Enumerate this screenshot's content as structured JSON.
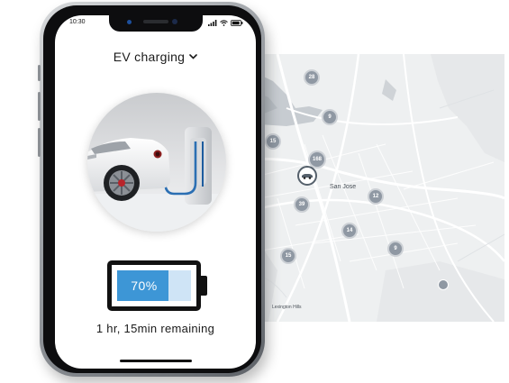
{
  "status_bar": {
    "time": "10:30",
    "icons": [
      "signal-icon",
      "wifi-icon",
      "battery-icon"
    ]
  },
  "app": {
    "title": "EV charging",
    "dropdown_icon": "chevron-down-icon"
  },
  "charging": {
    "percent_label": "70%",
    "level": 0.7,
    "remaining_text": "1 hr, 15min remaining"
  },
  "map": {
    "city_label": "San Jose",
    "area_label": "Lexington Hills",
    "clusters": [
      "28",
      "9",
      "15",
      "168",
      "74",
      "12",
      "39",
      "14",
      "9",
      "15"
    ]
  },
  "colors": {
    "battery_fill": "#3d96d6",
    "battery_track": "#cfe4f6",
    "cluster": "#8f98a3",
    "map_background": "#eef0f1"
  }
}
